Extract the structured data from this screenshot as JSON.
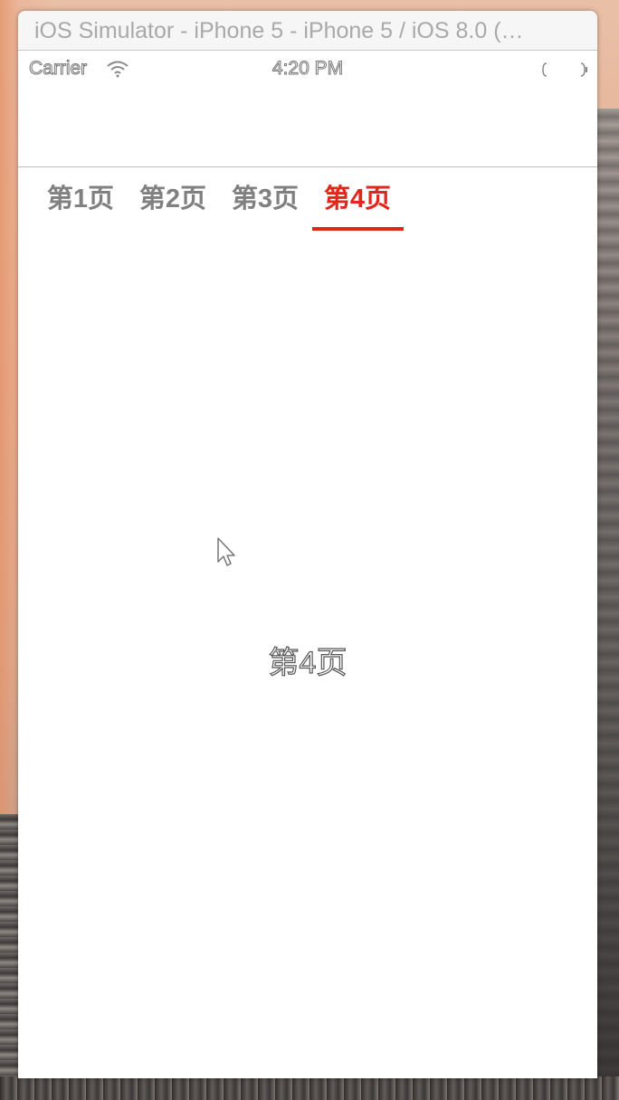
{
  "window": {
    "title": "iOS Simulator - iPhone 5 - iPhone 5 / iOS 8.0 (…"
  },
  "status_bar": {
    "carrier": "Carrier",
    "time": "4:20 PM",
    "wifi_icon": "wifi-icon",
    "battery_icon": "battery-icon"
  },
  "tabs": [
    {
      "label": "第1页",
      "active": false
    },
    {
      "label": "第2页",
      "active": false
    },
    {
      "label": "第3页",
      "active": false
    },
    {
      "label": "第4页",
      "active": true
    }
  ],
  "content": {
    "page_label": "第4页"
  },
  "colors": {
    "active_tab": "#e0271a",
    "inactive_tab": "#808080"
  }
}
